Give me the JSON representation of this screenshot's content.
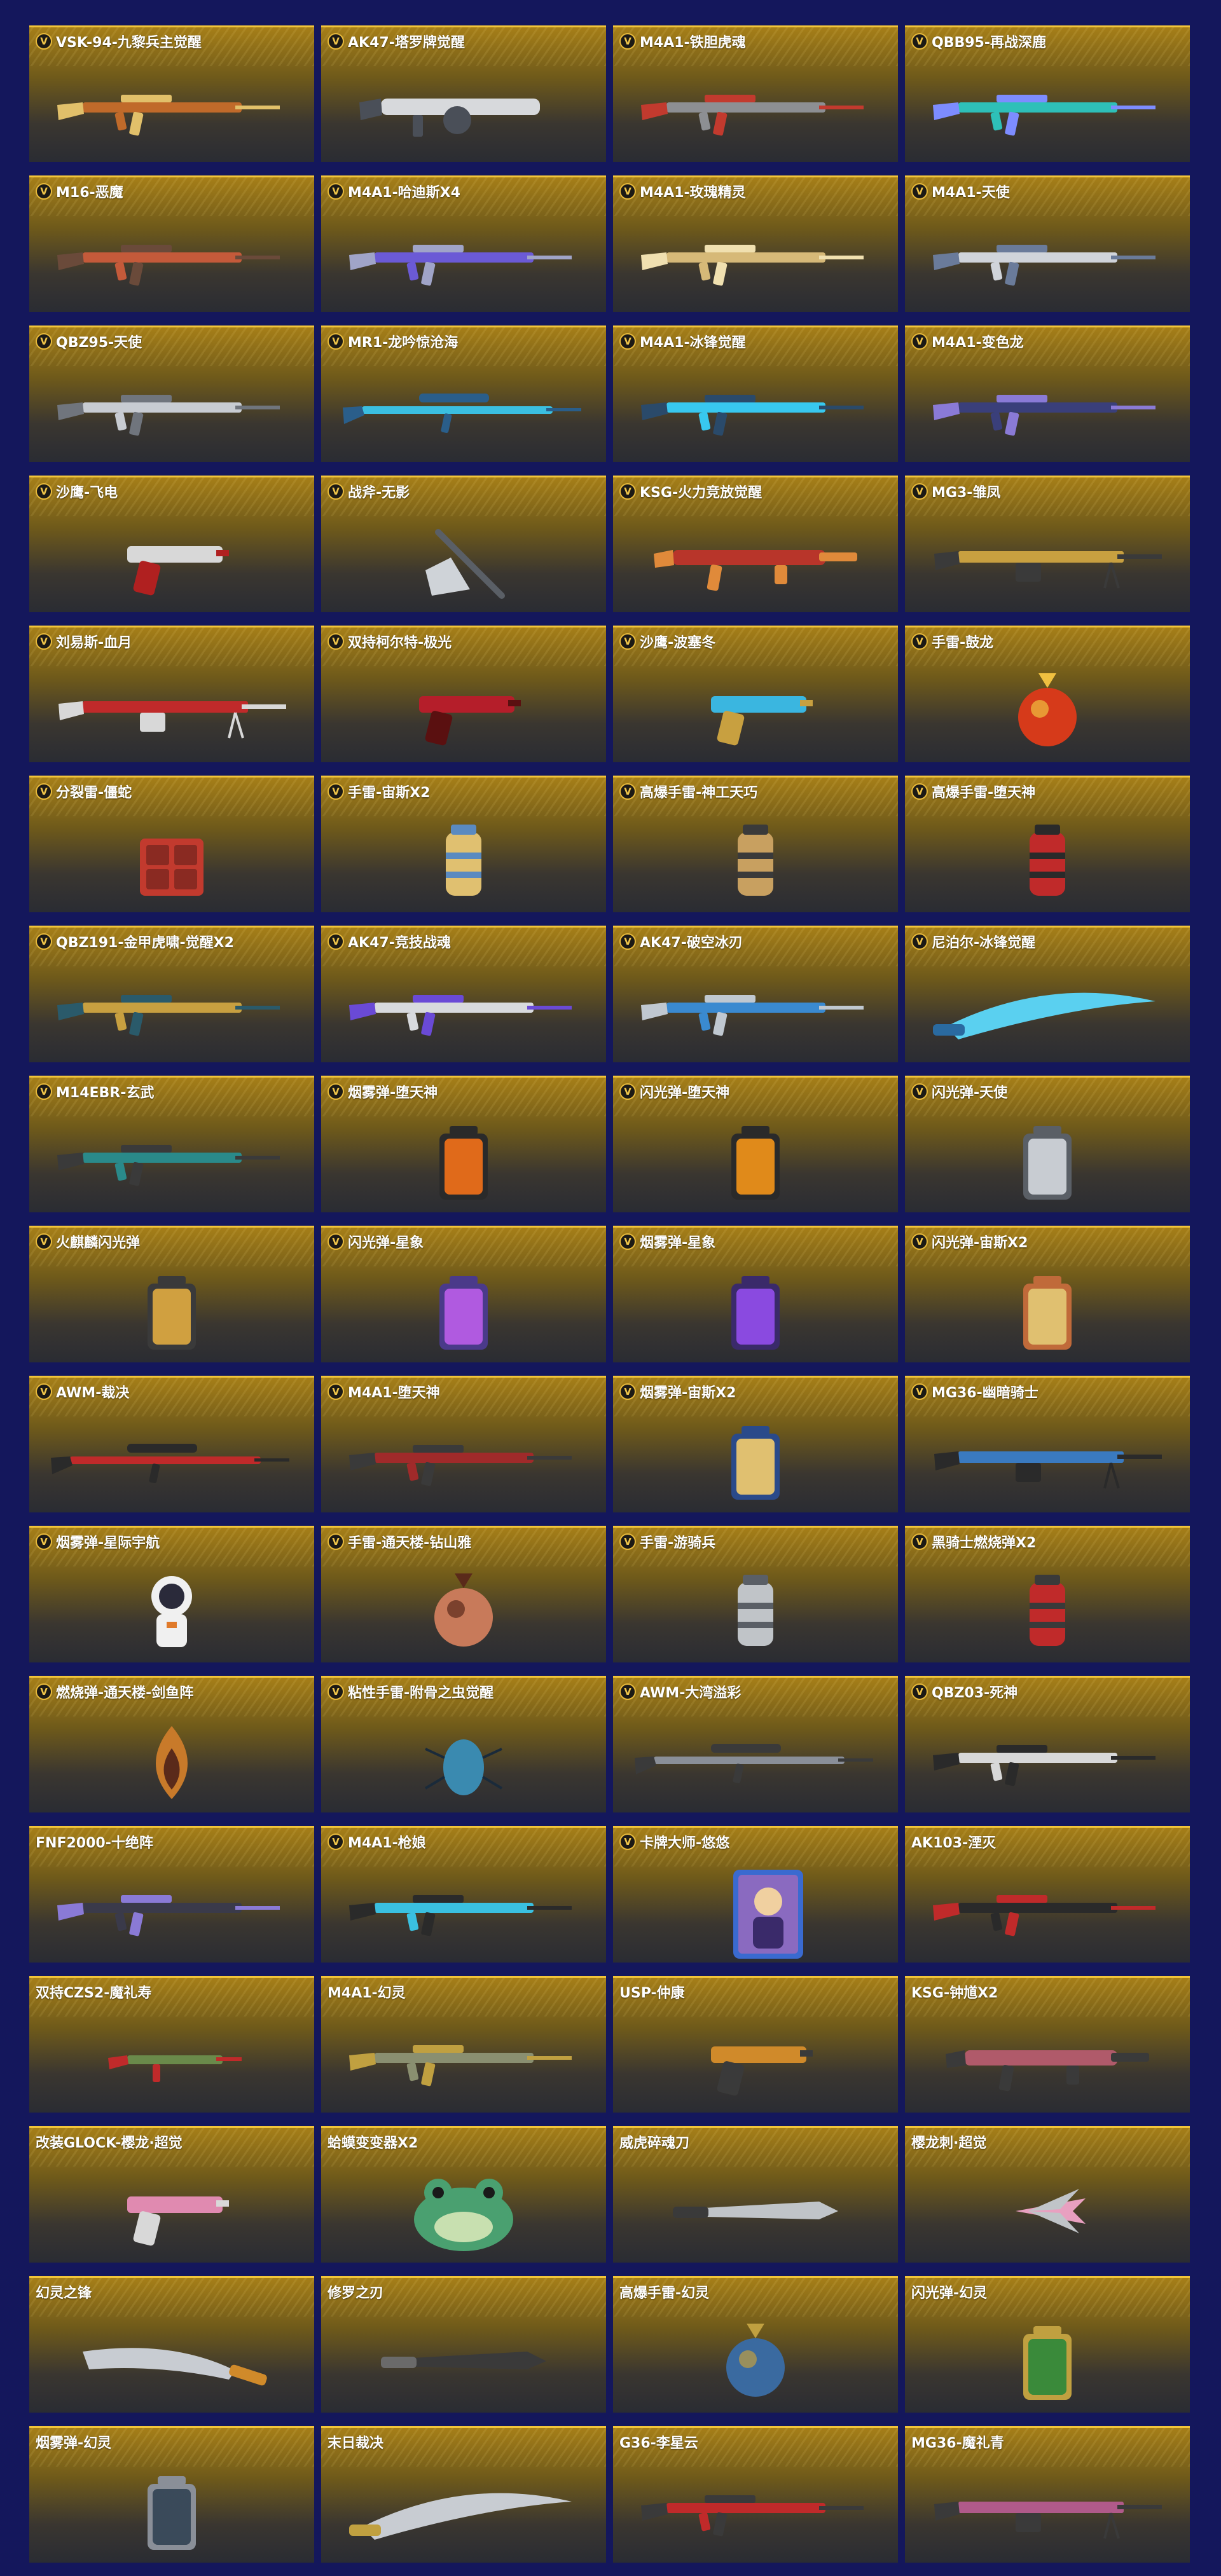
{
  "items": [
    {
      "name": "VSK-94-九黎兵主觉醒",
      "badge": true,
      "type": "rifle",
      "c1": "#c06a2a",
      "c2": "#e1c06a"
    },
    {
      "name": "AK47-塔罗牌觉醒",
      "badge": true,
      "type": "launcher",
      "c1": "#d7d9dc",
      "c2": "#4a4f58"
    },
    {
      "name": "M4A1-铁胆虎魂",
      "badge": true,
      "type": "rifle",
      "c1": "#8d8f93",
      "c2": "#c23a2e"
    },
    {
      "name": "QBB95-再战深鹿",
      "badge": true,
      "type": "rifle",
      "c1": "#2ec0b8",
      "c2": "#7d8cff"
    },
    {
      "name": "M16-恶魔",
      "badge": true,
      "type": "rifle",
      "c1": "#c45a3a",
      "c2": "#6a4a3a"
    },
    {
      "name": "M4A1-哈迪斯X4",
      "badge": true,
      "type": "rifle",
      "c1": "#6b5ad6",
      "c2": "#a0a4c8"
    },
    {
      "name": "M4A1-玫瑰精灵",
      "badge": true,
      "type": "rifle",
      "c1": "#d6b978",
      "c2": "#f0e0b0"
    },
    {
      "name": "M4A1-天使",
      "badge": true,
      "type": "rifle",
      "c1": "#d0d4da",
      "c2": "#6a7b9a"
    },
    {
      "name": "QBZ95-天使",
      "badge": true,
      "type": "rifle",
      "c1": "#c8ccd2",
      "c2": "#70757d"
    },
    {
      "name": "MR1-龙吟惊沧海",
      "badge": true,
      "type": "sniper",
      "c1": "#3bbfe0",
      "c2": "#2a5e8a"
    },
    {
      "name": "M4A1-冰锋觉醒",
      "badge": true,
      "type": "rifle",
      "c1": "#38c8ef",
      "c2": "#2a4a6a"
    },
    {
      "name": "M4A1-变色龙",
      "badge": true,
      "type": "rifle",
      "c1": "#3a3f7a",
      "c2": "#8a7ad6"
    },
    {
      "name": "沙鹰-飞电",
      "badge": true,
      "type": "pistol",
      "c1": "#d8d8d8",
      "c2": "#b02020"
    },
    {
      "name": "战斧-无影",
      "badge": true,
      "type": "axe",
      "c1": "#cfd3d8",
      "c2": "#5a5f66"
    },
    {
      "name": "KSG-火力竞放觉醒",
      "badge": true,
      "type": "shotgun",
      "c1": "#b8352a",
      "c2": "#e08a3a"
    },
    {
      "name": "MG3-雏凤",
      "badge": true,
      "type": "mg",
      "c1": "#c8a040",
      "c2": "#3a3a3a"
    },
    {
      "name": "刘易斯-血月",
      "badge": true,
      "type": "mg",
      "c1": "#c02a2a",
      "c2": "#d8d8d8"
    },
    {
      "name": "双持柯尔特-极光",
      "badge": true,
      "type": "pistol",
      "c1": "#b51e2a",
      "c2": "#5a1010"
    },
    {
      "name": "沙鹰-波塞冬",
      "badge": true,
      "type": "pistol",
      "c1": "#3ab6e0",
      "c2": "#c8a040"
    },
    {
      "name": "手雷-鼓龙",
      "badge": true,
      "type": "orb",
      "c1": "#d63a1a",
      "c2": "#f0c040"
    },
    {
      "name": "分裂雷-僵蛇",
      "badge": true,
      "type": "cube",
      "c1": "#c23a2e",
      "c2": "#8a2a22"
    },
    {
      "name": "手雷-宙斯X2",
      "badge": true,
      "type": "grenade",
      "c1": "#e0c070",
      "c2": "#5a8ac0"
    },
    {
      "name": "高爆手雷-神工天巧",
      "badge": true,
      "type": "grenade",
      "c1": "#c8a060",
      "c2": "#3a3a3a"
    },
    {
      "name": "高爆手雷-堕天神",
      "badge": true,
      "type": "grenade",
      "c1": "#c02a2a",
      "c2": "#2a2a2a"
    },
    {
      "name": "QBZ191-金甲虎啸-觉醒X2",
      "badge": true,
      "type": "rifle",
      "c1": "#c8a040",
      "c2": "#2a5a6a"
    },
    {
      "name": "AK47-竞技战魂",
      "badge": true,
      "type": "rifle",
      "c1": "#d8dadd",
      "c2": "#6a4ad6"
    },
    {
      "name": "AK47-破空冰刃",
      "badge": true,
      "type": "rifle",
      "c1": "#3a8ad0",
      "c2": "#c0c8d0"
    },
    {
      "name": "尼泊尔-冰锋觉醒",
      "badge": true,
      "type": "blade",
      "c1": "#5ad0f0",
      "c2": "#2a6aa0"
    },
    {
      "name": "M14EBR-玄武",
      "badge": true,
      "type": "rifle",
      "c1": "#2a8a8a",
      "c2": "#3a3a3a"
    },
    {
      "name": "烟雾弹-堕天神",
      "badge": true,
      "type": "canister",
      "c1": "#e06a1a",
      "c2": "#2a2a2a"
    },
    {
      "name": "闪光弹-堕天神",
      "badge": true,
      "type": "canister",
      "c1": "#e08a1a",
      "c2": "#2a2a2a"
    },
    {
      "name": "闪光弹-天使",
      "badge": true,
      "type": "canister",
      "c1": "#c8ccd2",
      "c2": "#5a5f66"
    },
    {
      "name": "火麒麟闪光弹",
      "badge": true,
      "type": "canister",
      "c1": "#d0a040",
      "c2": "#3a3a3a"
    },
    {
      "name": "闪光弹-星象",
      "badge": true,
      "type": "canister",
      "c1": "#b05ae0",
      "c2": "#4a3a8a"
    },
    {
      "name": "烟雾弹-星象",
      "badge": true,
      "type": "canister",
      "c1": "#8a4ae0",
      "c2": "#3a2a6a"
    },
    {
      "name": "闪光弹-宙斯X2",
      "badge": true,
      "type": "canister",
      "c1": "#e0c070",
      "c2": "#c06a3a"
    },
    {
      "name": "AWM-裁决",
      "badge": true,
      "type": "sniper",
      "c1": "#c02a2a",
      "c2": "#2a2a2a"
    },
    {
      "name": "M4A1-堕天神",
      "badge": true,
      "type": "rifle",
      "c1": "#a02a2a",
      "c2": "#3a3a3a"
    },
    {
      "name": "烟雾弹-宙斯X2",
      "badge": true,
      "type": "canister",
      "c1": "#e0c070",
      "c2": "#2a4a8a"
    },
    {
      "name": "MG36-幽暗骑士",
      "badge": true,
      "type": "mg",
      "c1": "#3a7ac0",
      "c2": "#2a2a2a"
    },
    {
      "name": "烟雾弹-星际宇航",
      "badge": true,
      "type": "astronaut",
      "c1": "#f0f0f0",
      "c2": "#e07a2a"
    },
    {
      "name": "手雷-通天楼-钻山雅",
      "badge": true,
      "type": "orb",
      "c1": "#c87a5a",
      "c2": "#5a2a1a"
    },
    {
      "name": "手雷-游骑兵",
      "badge": true,
      "type": "grenade",
      "c1": "#c0c4c8",
      "c2": "#5a5f66"
    },
    {
      "name": "黑骑士燃烧弹X2",
      "badge": true,
      "type": "grenade",
      "c1": "#c02a2a",
      "c2": "#3a3a3a"
    },
    {
      "name": "燃烧弹-通天楼-剑鱼阵",
      "badge": true,
      "type": "flame",
      "c1": "#c87a2a",
      "c2": "#5a2a1a"
    },
    {
      "name": "粘性手雷-附骨之虫觉醒",
      "badge": true,
      "type": "bug",
      "c1": "#3a8ab0",
      "c2": "#1a2a3a"
    },
    {
      "name": "AWM-大湾溢彩",
      "badge": true,
      "type": "sniper",
      "c1": "#8a8f98",
      "c2": "#3a3a3a"
    },
    {
      "name": "QBZ03-死神",
      "badge": true,
      "type": "rifle",
      "c1": "#d8d8d8",
      "c2": "#2a2a2a"
    },
    {
      "name": "FNF2000-十绝阵",
      "badge": false,
      "type": "rifle",
      "c1": "#3a3a4a",
      "c2": "#8a7ad6"
    },
    {
      "name": "M4A1-枪娘",
      "badge": true,
      "type": "rifle",
      "c1": "#3ac0e0",
      "c2": "#2a2a2a"
    },
    {
      "name": "卡牌大师-悠悠",
      "badge": true,
      "type": "card",
      "c1": "#8a6ac0",
      "c2": "#f0d0a0"
    },
    {
      "name": "AK103-湮灭",
      "badge": false,
      "type": "rifle",
      "c1": "#2a2a2a",
      "c2": "#c02a2a"
    },
    {
      "name": "双持CZS2-魔礼寿",
      "badge": false,
      "type": "smg",
      "c1": "#6a8a4a",
      "c2": "#c02a2a"
    },
    {
      "name": "M4A1-幻灵",
      "badge": false,
      "type": "rifle",
      "c1": "#8a8f70",
      "c2": "#c0a040"
    },
    {
      "name": "USP-仲康",
      "badge": false,
      "type": "pistol",
      "c1": "#d08a2a",
      "c2": "#3a3a3a"
    },
    {
      "name": "KSG-钟馗X2",
      "badge": false,
      "type": "shotgun",
      "c1": "#b05a6a",
      "c2": "#3a3a3a"
    },
    {
      "name": "改装GLOCK-樱龙·超觉",
      "badge": false,
      "type": "pistol",
      "c1": "#e08ab0",
      "c2": "#d8d8d8"
    },
    {
      "name": "蛤蟆变变器X2",
      "badge": false,
      "type": "frog",
      "c1": "#4aa070",
      "c2": "#c8e0b0"
    },
    {
      "name": "威虎碎魂刀",
      "badge": false,
      "type": "knife",
      "c1": "#c0c4c8",
      "c2": "#3a3a3a"
    },
    {
      "name": "樱龙刺·超觉",
      "badge": false,
      "type": "claw",
      "c1": "#e8a0c0",
      "c2": "#c0c4c8"
    },
    {
      "name": "幻灵之锋",
      "badge": false,
      "type": "machete",
      "c1": "#c8ccd2",
      "c2": "#d08a2a"
    },
    {
      "name": "修罗之刃",
      "badge": false,
      "type": "knife",
      "c1": "#3a3a3a",
      "c2": "#6a6a6a"
    },
    {
      "name": "高爆手雷-幻灵",
      "badge": false,
      "type": "orb",
      "c1": "#3a6aa0",
      "c2": "#c0a040"
    },
    {
      "name": "闪光弹-幻灵",
      "badge": false,
      "type": "canister",
      "c1": "#3a8a3a",
      "c2": "#c0a040"
    },
    {
      "name": "烟雾弹-幻灵",
      "badge": false,
      "type": "canister",
      "c1": "#3a4a5a",
      "c2": "#8a8f98"
    },
    {
      "name": "末日裁决",
      "badge": false,
      "type": "blade",
      "c1": "#c8ccd2",
      "c2": "#c0a040"
    },
    {
      "name": "G36-李星云",
      "badge": false,
      "type": "rifle",
      "c1": "#c02a2a",
      "c2": "#3a3a3a"
    },
    {
      "name": "MG36-魔礼青",
      "badge": false,
      "type": "mg",
      "c1": "#b05a8a",
      "c2": "#3a3a3a"
    }
  ]
}
